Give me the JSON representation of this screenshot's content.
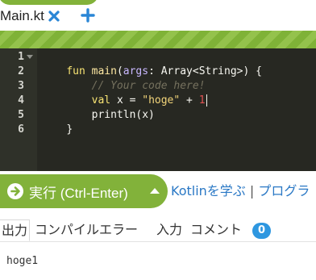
{
  "tabs": {
    "file_label": "Main.kt"
  },
  "editor": {
    "line_numbers": [
      "1",
      "2",
      "3",
      "4",
      "5",
      "6"
    ],
    "lines": [
      [
        {
          "text": "fun ",
          "kind": "kw"
        },
        {
          "text": "main",
          "kind": "fn"
        },
        {
          "text": "(",
          "kind": "plain"
        },
        {
          "text": "args",
          "kind": "param"
        },
        {
          "text": ": Array<",
          "kind": "plain"
        },
        {
          "text": "String",
          "kind": "plain"
        },
        {
          "text": ">) {",
          "kind": "plain"
        }
      ],
      [
        {
          "text": "    // Your code here!",
          "kind": "comment"
        }
      ],
      [
        {
          "text": "    ",
          "kind": "plain"
        },
        {
          "text": "val ",
          "kind": "kw"
        },
        {
          "text": "x = ",
          "kind": "plain"
        },
        {
          "text": "\"hoge\"",
          "kind": "str"
        },
        {
          "text": " + ",
          "kind": "plain"
        },
        {
          "text": "1",
          "kind": "num"
        }
      ],
      [
        {
          "text": "    println(x)",
          "kind": "plain"
        }
      ],
      [
        {
          "text": "}",
          "kind": "plain"
        }
      ],
      []
    ],
    "colors": {
      "background": "#272822",
      "keyword": "#f8e473",
      "comment": "#75715e",
      "number": "#e25252"
    }
  },
  "run": {
    "label": "実行 (Ctrl-Enter)",
    "accent": "#82b23a"
  },
  "links": {
    "learn": "Kotlinを学ぶ",
    "separator": "|",
    "program": "プログラ"
  },
  "result_tabs": {
    "output": "出力",
    "compile_error": "コンパイルエラー",
    "input": "入力",
    "comment": "コメント",
    "comment_count": "0"
  },
  "output": {
    "text": "hoge1"
  }
}
